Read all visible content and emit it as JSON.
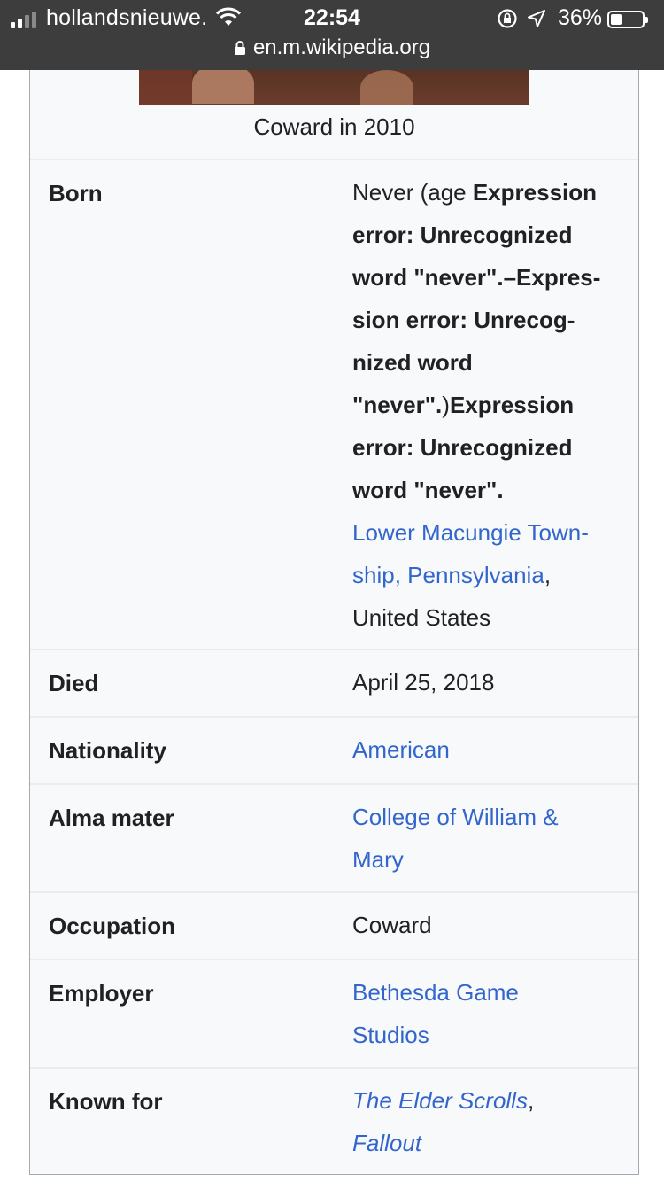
{
  "status_bar": {
    "carrier": "hollandsnieuwe.",
    "time": "22:54",
    "battery_percent": "36%",
    "battery_level": 0.36,
    "url": "en.m.wikipedia.org"
  },
  "infobox": {
    "image_caption": "Coward in 2010",
    "rows": [
      {
        "label": "Born",
        "value_parts": {
          "p1": "Never (age ",
          "b1": "Expression error: Unrecognized word \"never\".–Expres­sion error: Unrecog­nized word \"never\".",
          "p2": ")",
          "b2": "Expression error: Unrecognized word \"never\".",
          "link": "Lower Macungie Town­ship, Pennsylvania",
          "p3": ",",
          "p4": "United States"
        }
      },
      {
        "label": "Died",
        "value": "April 25, 2018"
      },
      {
        "label": "Nationality",
        "value_link": "American"
      },
      {
        "label": "Alma mater",
        "value_link": "College of William & Mary"
      },
      {
        "label": "Occupation",
        "value": "Coward"
      },
      {
        "label": "Employer",
        "value_link": "Bethesda Game Studios"
      },
      {
        "label": "Known for",
        "value_parts": {
          "link1": "The Elder Scrolls",
          "sep": ",",
          "link2": "Fallout"
        }
      }
    ]
  }
}
